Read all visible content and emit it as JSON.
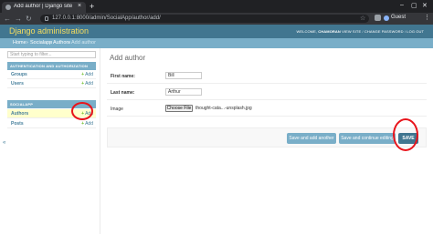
{
  "browser": {
    "tab_title": "Add author | Django site",
    "close_tab": "×",
    "new_tab": "+",
    "url": "127.0.0.1:8000/admin/SocialApp/author/add/",
    "profile_label": "Guest",
    "window_controls": [
      "–",
      "▢",
      "✕"
    ]
  },
  "header": {
    "branding": "Django administration",
    "welcome": "WELCOME,",
    "username": "CHAMORAN",
    "links": [
      "VIEW SITE",
      "CHANGE PASSWORD",
      "LOG OUT"
    ]
  },
  "breadcrumbs": [
    "Home",
    "Socialapp",
    "Authors",
    "Add author"
  ],
  "sidebar": {
    "filter_placeholder": "Start typing to filter...",
    "apps": [
      {
        "caption": "AUTHENTICATION AND AUTHORIZATION",
        "models": [
          {
            "name": "Groups",
            "add": "Add"
          },
          {
            "name": "Users",
            "add": "Add"
          }
        ]
      },
      {
        "caption": "SOCIALAPP",
        "models": [
          {
            "name": "Authors",
            "add": "Add",
            "current": true
          },
          {
            "name": "Posts",
            "add": "Add"
          }
        ]
      }
    ],
    "collapse_glyph": "«"
  },
  "content": {
    "title": "Add author",
    "fields": [
      {
        "label": "First name:",
        "value": "Bill",
        "required": true
      },
      {
        "label": "Last name:",
        "value": "Arthur",
        "required": true
      },
      {
        "label": "Image",
        "button": "Choose File",
        "file": "thought-cata...-unsplash.jpg",
        "required": false
      }
    ],
    "buttons": {
      "save_add_another": "Save and add another",
      "save_continue": "Save and continue editing",
      "save": "SAVE"
    }
  },
  "colors": {
    "header": "#417690",
    "breadcrumbs": "#79aec8",
    "branding": "#f5dd5d",
    "annotation": "#e8141b"
  }
}
